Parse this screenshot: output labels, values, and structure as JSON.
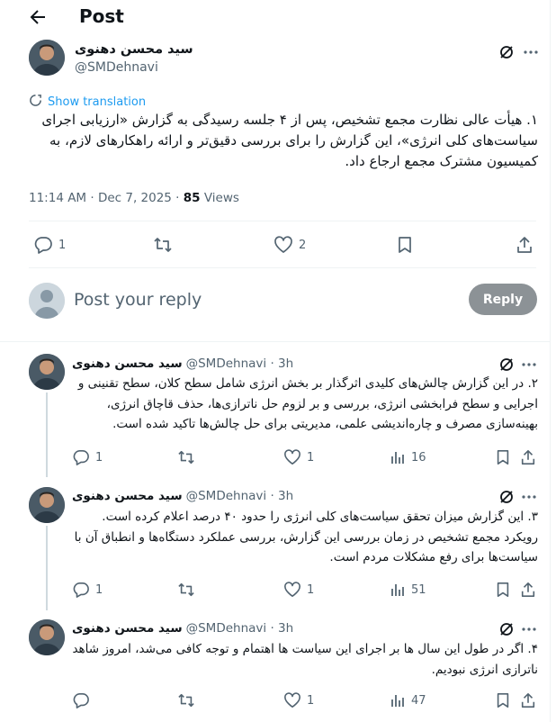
{
  "header": {
    "title": "Post"
  },
  "main_post": {
    "author_name": "سید محسن دهنوی",
    "handle": "@SMDehnavi",
    "show_translation": "Show translation",
    "text": "۱. هیأت عالی نظارت مجمع تشخیص، پس از ۴ جلسه رسیدگی به گزارش «ارزیابی اجرای سیاست‌های کلی انرژی»، این گزارش را برای بررسی دقیق‌تر و ارائه راهکارهای لازم، به کمیسیون مشترک مجمع ارجاع داد.",
    "time_date": "11:14 AM · Dec 7, 2025 · ",
    "views_count": "85",
    "views_label": " Views",
    "replies": "1",
    "likes": "2"
  },
  "reply_box": {
    "placeholder": "Post your reply",
    "button": "Reply"
  },
  "replies": [
    {
      "author_name": "سید محسن دهنوی",
      "handle": "@SMDehnavi · 3h",
      "text": "۲. در این گزارش چالش‌های کلیدی اثرگذار بر بخش انرژی شامل سطح کلان، سطح تقنینی و اجرایی و سطح فرابخشی انرژی، بررسی و بر لزوم حل ناترازی‌ها، حذف قاچاق انرژی، بهینه‌سازی مصرف و چاره‌اندیشی علمی، مدیریتی برای حل چالش‌ها تاکید شده است.",
      "replies": "1",
      "likes": "1",
      "views": "16"
    },
    {
      "author_name": "سید محسن دهنوی",
      "handle": "@SMDehnavi · 3h",
      "text": "۳. این گزارش میزان تحقق سیاست‌های کلی انرژی را حدود ۴۰ درصد اعلام کرده است. رویکرد مجمع تشخیص در زمان بررسی این گزارش، بررسی عملکرد دستگاه‌ها و انطباق آن با سیاست‌ها برای رفع مشکلات مردم است.",
      "replies": "1",
      "likes": "1",
      "views": "51"
    },
    {
      "author_name": "سید محسن دهنوی",
      "handle": "@SMDehnavi · 3h",
      "text": "۴. اگر در طول این سال ها بر اجرای این سیاست ها اهتمام و توجه کافی می‌شد، امروز شاهد ناترازی انرژی نبودیم.",
      "replies": "",
      "likes": "1",
      "views": "47"
    }
  ],
  "colors": {
    "text": "#0f1419",
    "secondary": "#536471",
    "link": "#1d9bf0",
    "reply_button": "#8c9296"
  }
}
